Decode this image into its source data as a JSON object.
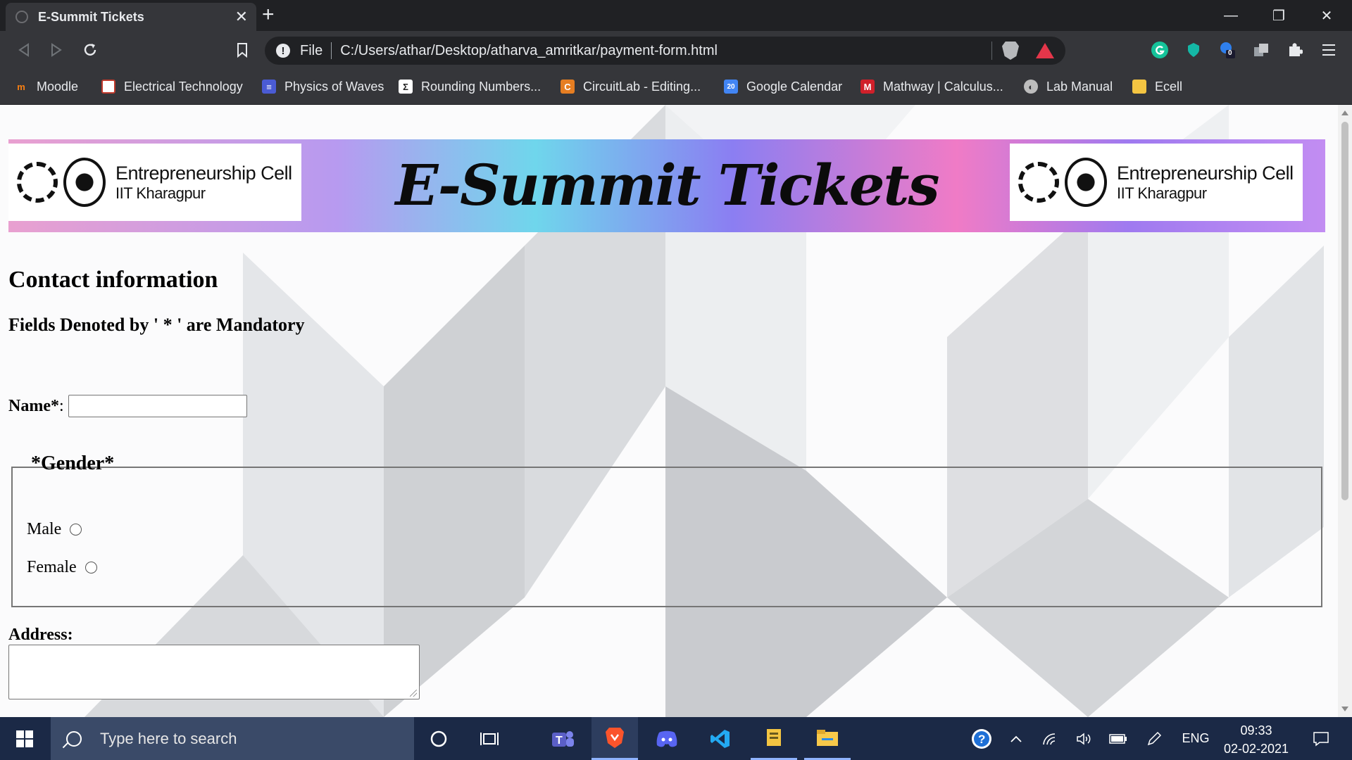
{
  "browser": {
    "tab_title": "E-Summit Tickets",
    "tab_close": "✕",
    "new_tab": "+",
    "scheme": "File",
    "url": "C:/Users/athar/Desktop/atharva_amritkar/payment-form.html",
    "extension_badge": "0",
    "window_controls": {
      "minimize": "—",
      "restore": "❐",
      "close": "✕"
    }
  },
  "bookmarks": [
    {
      "label": "Moodle",
      "icon": "moodle-icon",
      "color": "#f98012"
    },
    {
      "label": "Electrical Technology",
      "icon": "electrical-icon",
      "color": "#c0392b"
    },
    {
      "label": "Physics of Waves",
      "icon": "forms-icon",
      "color": "#4a5bd4"
    },
    {
      "label": "Rounding Numbers...",
      "icon": "sigma-icon",
      "color": "#222222"
    },
    {
      "label": "CircuitLab - Editing...",
      "icon": "circuitlab-icon",
      "color": "#e67e22"
    },
    {
      "label": "Google Calendar",
      "icon": "calendar-icon",
      "color": "#4285f4"
    },
    {
      "label": "Mathway | Calculus...",
      "icon": "mathway-icon",
      "color": "#d0202a"
    },
    {
      "label": "Lab Manual",
      "icon": "globe-icon",
      "color": "#bdbdbd"
    },
    {
      "label": "Ecell",
      "icon": "folder-icon",
      "color": "#f4c542"
    }
  ],
  "banner": {
    "title": "E-Summit Tickets",
    "logo_line1": "Entrepreneurship Cell",
    "logo_line2": "IIT Kharagpur"
  },
  "form": {
    "heading": "Contact information",
    "subheading": "Fields Denoted by ' * ' are Mandatory",
    "name_label": "Name*",
    "name_colon": ":",
    "name_value": "",
    "gender_legend": "*Gender*",
    "gender_options": [
      "Male",
      "Female"
    ],
    "address_label": "Address:",
    "address_value": ""
  },
  "taskbar": {
    "search_placeholder": "Type here to search",
    "language": "ENG",
    "time": "09:33",
    "date": "02-02-2021"
  }
}
